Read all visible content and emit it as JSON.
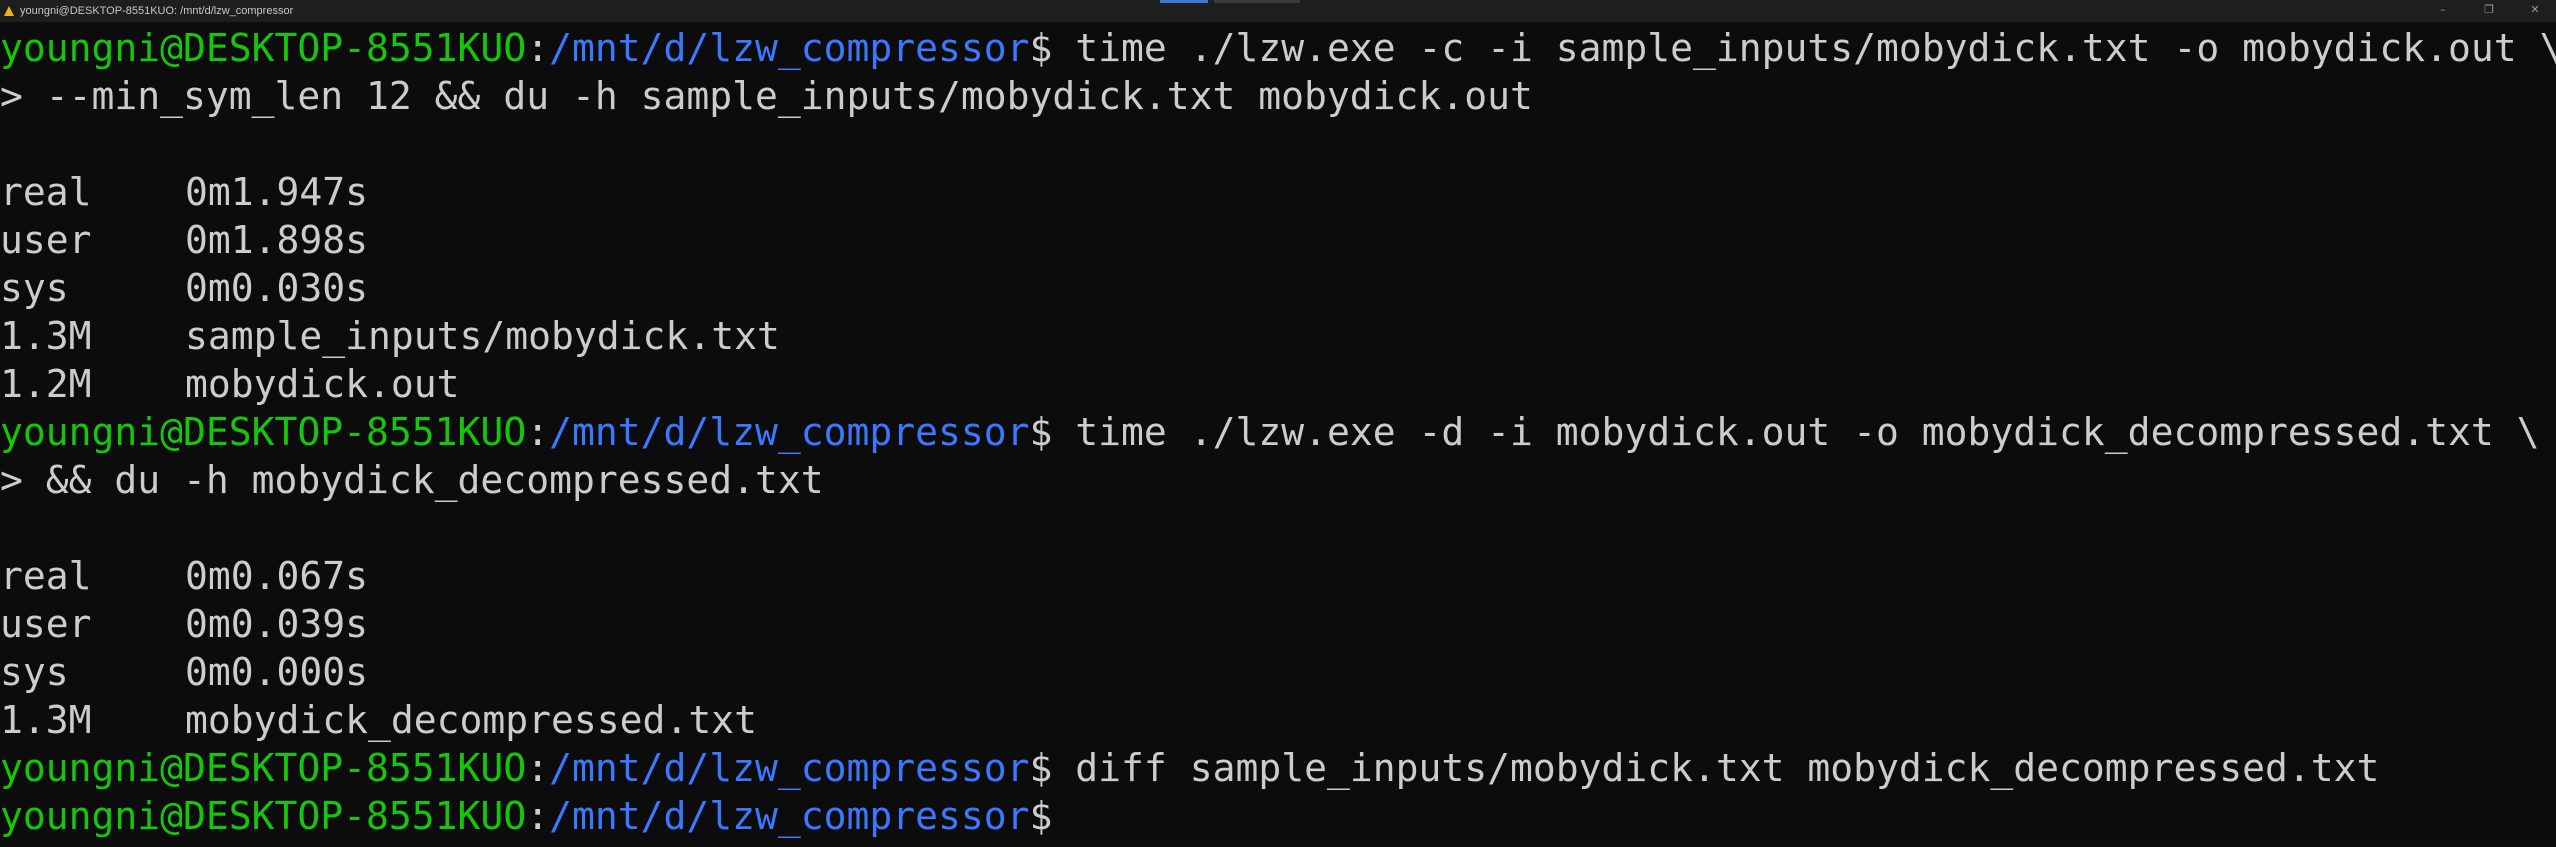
{
  "window": {
    "title": "youngni@DESKTOP-8551KUO: /mnt/d/lzw_compressor",
    "minimize_glyph": "–",
    "maximize_glyph": "❐",
    "close_glyph": "✕"
  },
  "prompt": {
    "user_host": "youngni@DESKTOP-8551KUO",
    "colon": ":",
    "path": "/mnt/d/lzw_compressor",
    "symbol": "$"
  },
  "colors": {
    "background": "#0c0c0c",
    "user_host": "#16c60c",
    "path": "#3b78ff",
    "text": "#cccccc"
  },
  "terminal": {
    "cmd1": " time ./lzw.exe -c -i sample_inputs/mobydick.txt -o mobydick.out \\",
    "cmd1_cont": "> --min_sym_len 12 && du -h sample_inputs/mobydick.txt mobydick.out",
    "run1": {
      "real_label": "real",
      "real_value": "0m1.947s",
      "user_label": "user",
      "user_value": "0m1.898s",
      "sys_label": "sys",
      "sys_value": "0m0.030s"
    },
    "du1": [
      {
        "size": "1.3M",
        "file": "sample_inputs/mobydick.txt"
      },
      {
        "size": "1.2M",
        "file": "mobydick.out"
      }
    ],
    "cmd2": " time ./lzw.exe -d -i mobydick.out -o mobydick_decompressed.txt \\",
    "cmd2_cont": "> && du -h mobydick_decompressed.txt",
    "run2": {
      "real_label": "real",
      "real_value": "0m0.067s",
      "user_label": "user",
      "user_value": "0m0.039s",
      "sys_label": "sys",
      "sys_value": "0m0.000s"
    },
    "du2": [
      {
        "size": "1.3M",
        "file": "mobydick_decompressed.txt"
      }
    ],
    "cmd3": " diff sample_inputs/mobydick.txt mobydick_decompressed.txt",
    "cmd4": ""
  }
}
